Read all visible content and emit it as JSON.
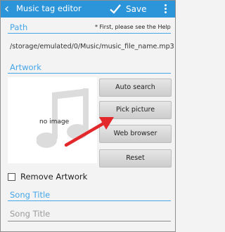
{
  "appbar": {
    "title": "Music tag editor",
    "save_label": "Save",
    "back_icon": "back-arrow-icon",
    "save_icon": "checkmark-icon",
    "more_icon": "overflow-menu-icon",
    "color": "#2c95d9"
  },
  "path_section": {
    "label": "Path",
    "help_note": "* First, please see the Help",
    "value": "/storage/emulated/0/Music/music_file_name.mp3"
  },
  "artwork_section": {
    "label": "Artwork",
    "placeholder_text": "no image",
    "placeholder_icon": "music-note-icon",
    "buttons": [
      {
        "label": "Auto search"
      },
      {
        "label": "Pick picture"
      },
      {
        "label": "Web browser"
      },
      {
        "label": "Reset"
      }
    ],
    "annotation": {
      "icon": "red-arrow-icon",
      "color": "#e3282c"
    },
    "remove_checkbox": {
      "label": "Remove Artwork",
      "checked": false
    }
  },
  "song_title_section": {
    "label": "Song Title",
    "placeholder": "Song Title",
    "value": ""
  },
  "colors": {
    "accent": "#44a5e8",
    "background": "#f3f3f3"
  }
}
